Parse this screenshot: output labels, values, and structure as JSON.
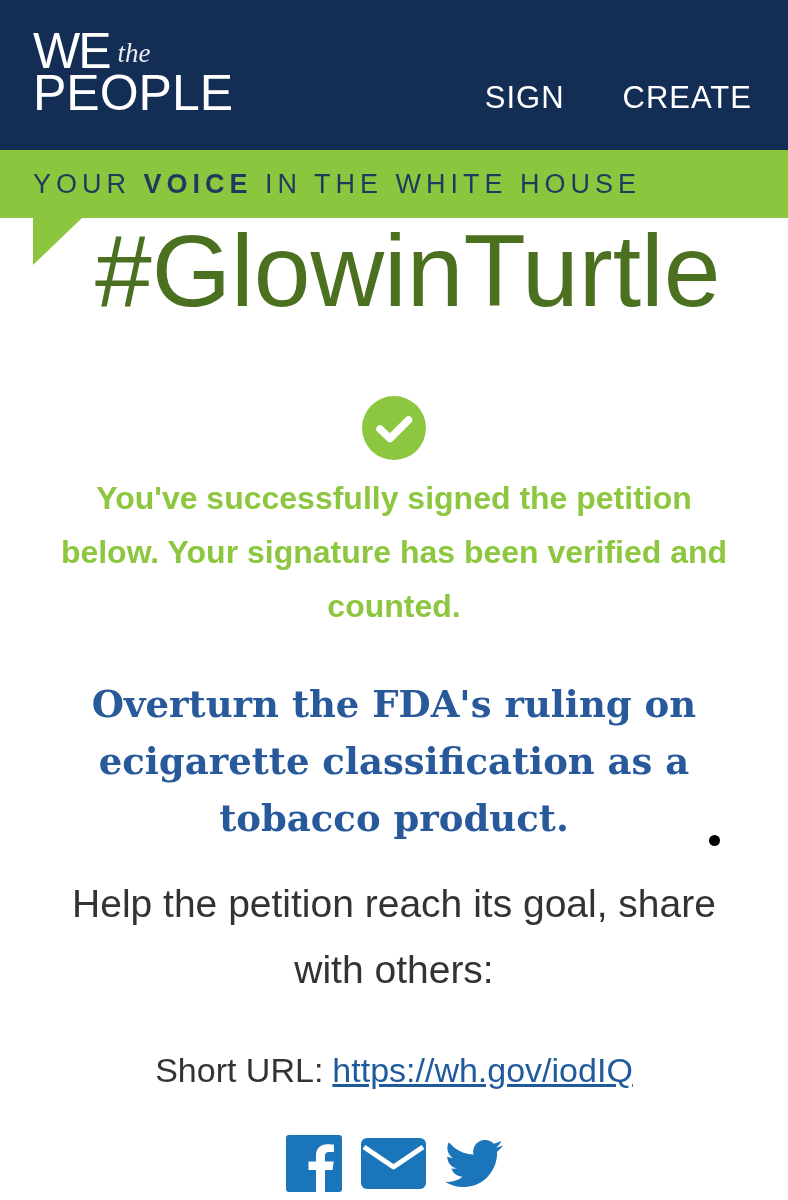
{
  "header": {
    "logo": {
      "top": "WE",
      "script": "the",
      "bottom": "PEOPLE"
    },
    "nav": [
      {
        "label": "SIGN"
      },
      {
        "label": "CREATE"
      }
    ]
  },
  "banner": {
    "tagline": "YOUR **VOICE** IN THE WHITE HOUSE"
  },
  "annotation": {
    "text": "#GlowinTurtle"
  },
  "confirmation": {
    "message": "You've successfully signed the petition below. Your signature has been verified and counted."
  },
  "petition": {
    "title": "Overturn the FDA's ruling on ecigarette classification as a tobacco product."
  },
  "share": {
    "prompt": "Help the petition reach its goal, share with others:",
    "short_url_label": "Short URL:",
    "short_url": "https://wh.gov/iodIQ",
    "networks": [
      {
        "kind": "facebook"
      },
      {
        "kind": "email"
      },
      {
        "kind": "twitter"
      }
    ]
  }
}
